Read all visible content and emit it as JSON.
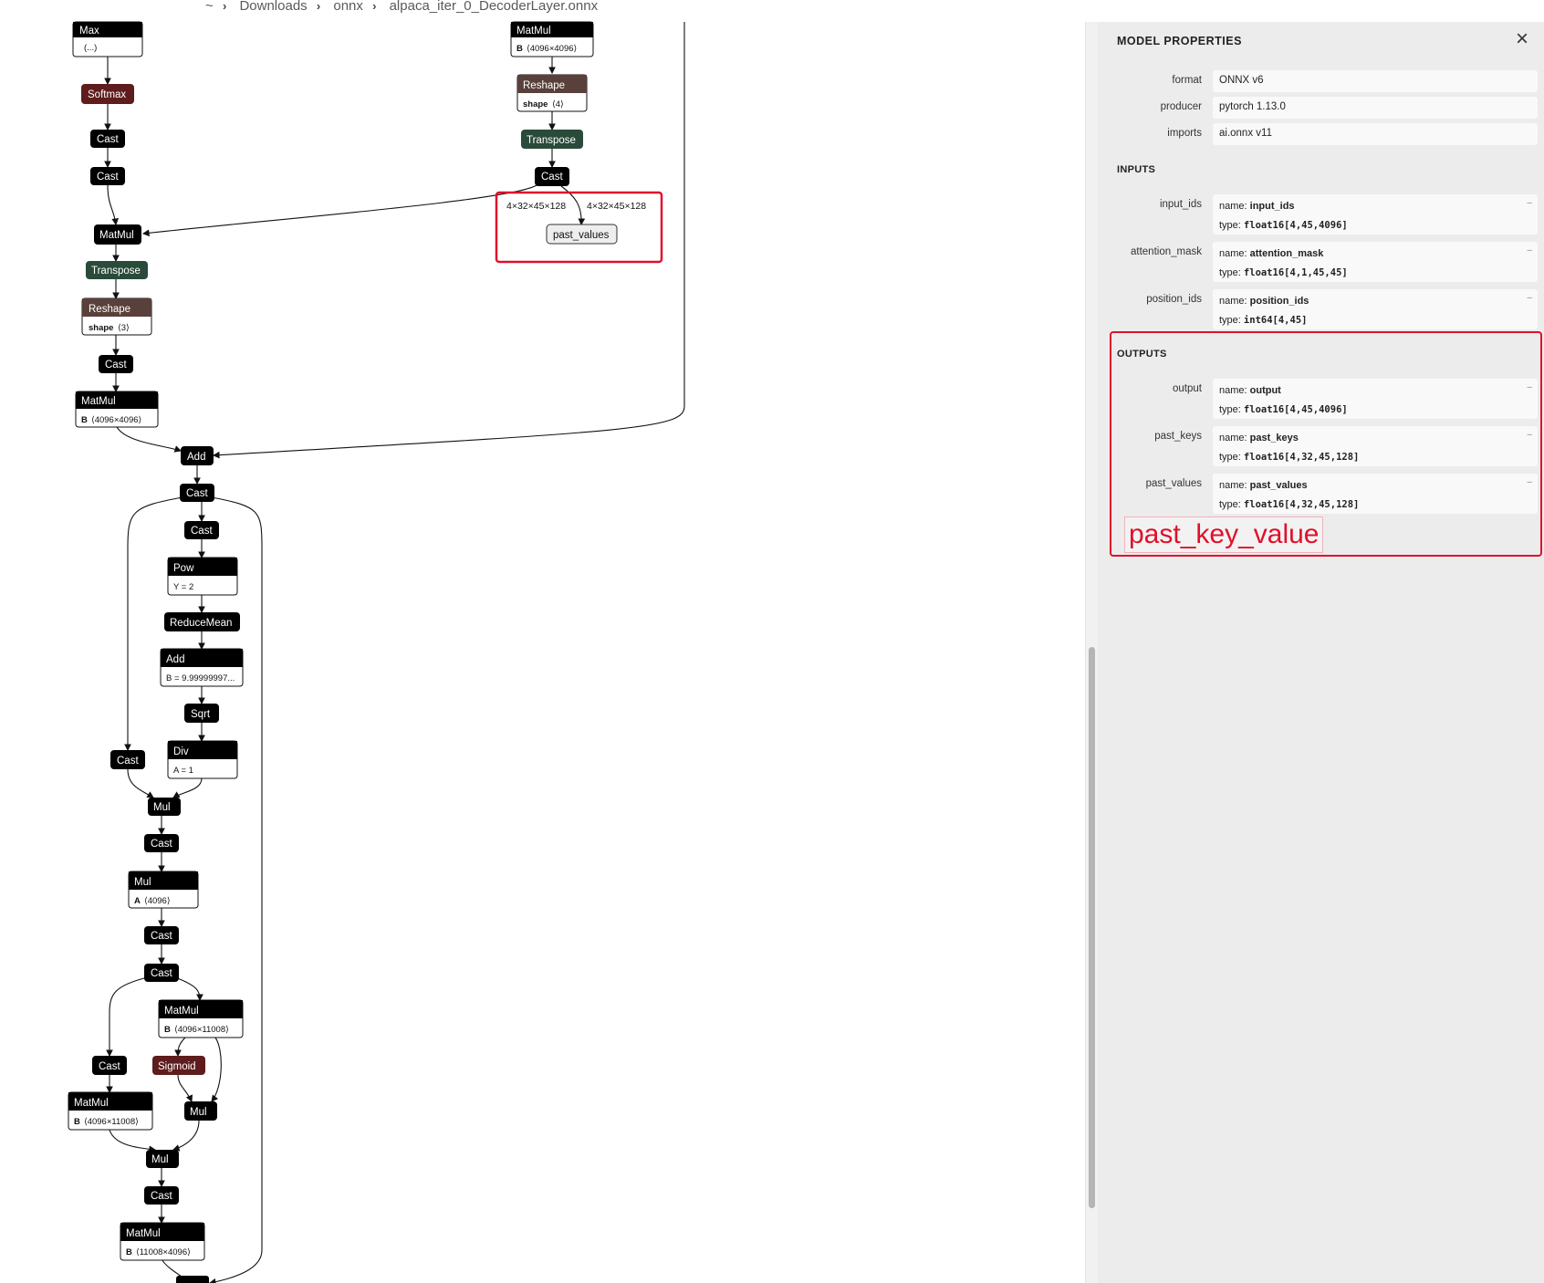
{
  "breadcrumb": {
    "home": "~",
    "p1": "Downloads",
    "p2": "onnx",
    "file": "alpaca_iter_0_DecoderLayer.onnx",
    "sep": "›"
  },
  "graph": {
    "nodes": {
      "max": {
        "op": "Max",
        "attr": "(...)"
      },
      "softmax": {
        "op": "Softmax"
      },
      "cast_a": {
        "op": "Cast"
      },
      "cast_b": {
        "op": "Cast"
      },
      "matmul_a": {
        "op": "MatMul"
      },
      "transpose_a": {
        "op": "Transpose"
      },
      "reshape_a": {
        "op": "Reshape",
        "attr_key": "shape",
        "attr_val": "⟨3⟩"
      },
      "cast_c": {
        "op": "Cast"
      },
      "matmul_b": {
        "op": "MatMul",
        "attr_key": "B",
        "attr_val": "⟨4096×4096⟩"
      },
      "matmul_top": {
        "op": "MatMul",
        "attr_key": "B",
        "attr_val": "⟨4096×4096⟩"
      },
      "reshape_top": {
        "op": "Reshape",
        "attr_key": "shape",
        "attr_val": "⟨4⟩"
      },
      "transpose_top": {
        "op": "Transpose"
      },
      "cast_top": {
        "op": "Cast"
      },
      "edge_label_1": "4×32×45×128",
      "edge_label_2": "4×32×45×128",
      "past_values_out": {
        "label": "past_values"
      },
      "add_a": {
        "op": "Add"
      },
      "cast_d": {
        "op": "Cast"
      },
      "cast_e": {
        "op": "Cast"
      },
      "pow": {
        "op": "Pow",
        "attr": "Y = 2"
      },
      "reducemean": {
        "op": "ReduceMean"
      },
      "add_b": {
        "op": "Add",
        "attr": "B = 9.99999997..."
      },
      "sqrt": {
        "op": "Sqrt"
      },
      "cast_f": {
        "op": "Cast"
      },
      "div": {
        "op": "Div",
        "attr": "A = 1"
      },
      "mul_a": {
        "op": "Mul"
      },
      "cast_g": {
        "op": "Cast"
      },
      "mul_b": {
        "op": "Mul",
        "attr_key": "A",
        "attr_val": "⟨4096⟩"
      },
      "cast_h": {
        "op": "Cast"
      },
      "cast_i": {
        "op": "Cast"
      },
      "matmul_c": {
        "op": "MatMul",
        "attr_key": "B",
        "attr_val": "⟨4096×11008⟩"
      },
      "cast_j": {
        "op": "Cast"
      },
      "sigmoid": {
        "op": "Sigmoid"
      },
      "matmul_d": {
        "op": "MatMul",
        "attr_key": "B",
        "attr_val": "⟨4096×11008⟩"
      },
      "mul_c": {
        "op": "Mul"
      },
      "mul_d": {
        "op": "Mul"
      },
      "cast_k": {
        "op": "Cast"
      },
      "matmul_e": {
        "op": "MatMul",
        "attr_key": "B",
        "attr_val": "⟨11008×4096⟩"
      }
    }
  },
  "panel": {
    "title": "MODEL PROPERTIES",
    "close_icon": "×",
    "properties": [
      {
        "label": "format",
        "value": "ONNX v6"
      },
      {
        "label": "producer",
        "value": "pytorch 1.13.0"
      },
      {
        "label": "imports",
        "value": "ai.onnx v11"
      }
    ],
    "inputs_title": "INPUTS",
    "inputs": [
      {
        "label": "input_ids",
        "name": "input_ids",
        "type": "float16[4,45,4096]"
      },
      {
        "label": "attention_mask",
        "name": "attention_mask",
        "type": "float16[4,1,45,45]"
      },
      {
        "label": "position_ids",
        "name": "position_ids",
        "type": "int64[4,45]"
      }
    ],
    "outputs_title": "OUTPUTS",
    "outputs": [
      {
        "label": "output",
        "name": "output",
        "type": "float16[4,45,4096]"
      },
      {
        "label": "past_keys",
        "name": "past_keys",
        "type": "float16[4,32,45,128]"
      },
      {
        "label": "past_values",
        "name": "past_values",
        "type": "float16[4,32,45,128]"
      }
    ],
    "name_prefix": "name:",
    "type_prefix": "type:",
    "dash": "–"
  },
  "annotation": {
    "text": "past_key_value",
    "color": "#e0102a"
  },
  "colors": {
    "node_black": "#000000",
    "node_red": "#5e1c1c",
    "node_green": "#2a4a3a",
    "node_brown": "#5a403a",
    "highlight": "#e0102a"
  }
}
